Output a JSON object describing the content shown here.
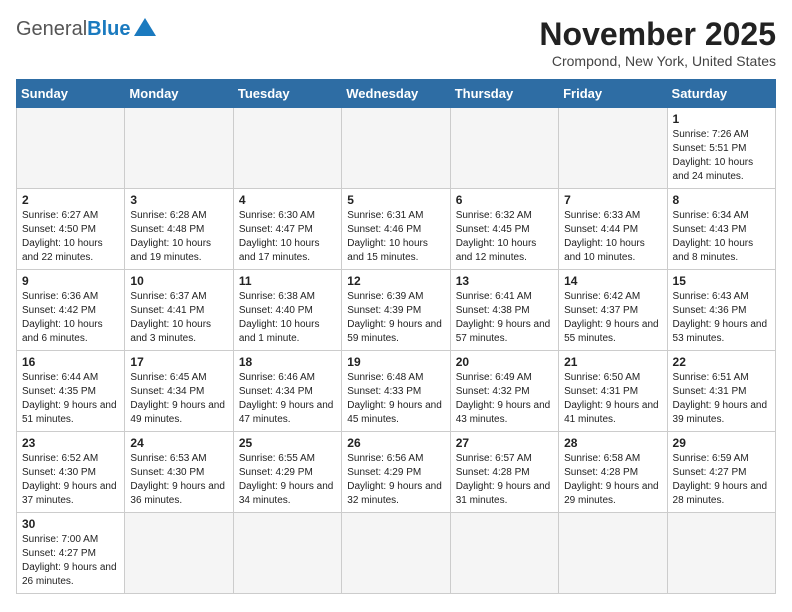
{
  "header": {
    "logo_general": "General",
    "logo_blue": "Blue",
    "title": "November 2025",
    "subtitle": "Crompond, New York, United States"
  },
  "weekdays": [
    "Sunday",
    "Monday",
    "Tuesday",
    "Wednesday",
    "Thursday",
    "Friday",
    "Saturday"
  ],
  "weeks": [
    [
      {
        "day": "",
        "info": "",
        "empty": true
      },
      {
        "day": "",
        "info": "",
        "empty": true
      },
      {
        "day": "",
        "info": "",
        "empty": true
      },
      {
        "day": "",
        "info": "",
        "empty": true
      },
      {
        "day": "",
        "info": "",
        "empty": true
      },
      {
        "day": "",
        "info": "",
        "empty": true
      },
      {
        "day": "1",
        "info": "Sunrise: 7:26 AM\nSunset: 5:51 PM\nDaylight: 10 hours and 24 minutes.",
        "empty": false
      }
    ],
    [
      {
        "day": "2",
        "info": "Sunrise: 6:27 AM\nSunset: 4:50 PM\nDaylight: 10 hours and 22 minutes.",
        "empty": false
      },
      {
        "day": "3",
        "info": "Sunrise: 6:28 AM\nSunset: 4:48 PM\nDaylight: 10 hours and 19 minutes.",
        "empty": false
      },
      {
        "day": "4",
        "info": "Sunrise: 6:30 AM\nSunset: 4:47 PM\nDaylight: 10 hours and 17 minutes.",
        "empty": false
      },
      {
        "day": "5",
        "info": "Sunrise: 6:31 AM\nSunset: 4:46 PM\nDaylight: 10 hours and 15 minutes.",
        "empty": false
      },
      {
        "day": "6",
        "info": "Sunrise: 6:32 AM\nSunset: 4:45 PM\nDaylight: 10 hours and 12 minutes.",
        "empty": false
      },
      {
        "day": "7",
        "info": "Sunrise: 6:33 AM\nSunset: 4:44 PM\nDaylight: 10 hours and 10 minutes.",
        "empty": false
      },
      {
        "day": "8",
        "info": "Sunrise: 6:34 AM\nSunset: 4:43 PM\nDaylight: 10 hours and 8 minutes.",
        "empty": false
      }
    ],
    [
      {
        "day": "9",
        "info": "Sunrise: 6:36 AM\nSunset: 4:42 PM\nDaylight: 10 hours and 6 minutes.",
        "empty": false
      },
      {
        "day": "10",
        "info": "Sunrise: 6:37 AM\nSunset: 4:41 PM\nDaylight: 10 hours and 3 minutes.",
        "empty": false
      },
      {
        "day": "11",
        "info": "Sunrise: 6:38 AM\nSunset: 4:40 PM\nDaylight: 10 hours and 1 minute.",
        "empty": false
      },
      {
        "day": "12",
        "info": "Sunrise: 6:39 AM\nSunset: 4:39 PM\nDaylight: 9 hours and 59 minutes.",
        "empty": false
      },
      {
        "day": "13",
        "info": "Sunrise: 6:41 AM\nSunset: 4:38 PM\nDaylight: 9 hours and 57 minutes.",
        "empty": false
      },
      {
        "day": "14",
        "info": "Sunrise: 6:42 AM\nSunset: 4:37 PM\nDaylight: 9 hours and 55 minutes.",
        "empty": false
      },
      {
        "day": "15",
        "info": "Sunrise: 6:43 AM\nSunset: 4:36 PM\nDaylight: 9 hours and 53 minutes.",
        "empty": false
      }
    ],
    [
      {
        "day": "16",
        "info": "Sunrise: 6:44 AM\nSunset: 4:35 PM\nDaylight: 9 hours and 51 minutes.",
        "empty": false
      },
      {
        "day": "17",
        "info": "Sunrise: 6:45 AM\nSunset: 4:34 PM\nDaylight: 9 hours and 49 minutes.",
        "empty": false
      },
      {
        "day": "18",
        "info": "Sunrise: 6:46 AM\nSunset: 4:34 PM\nDaylight: 9 hours and 47 minutes.",
        "empty": false
      },
      {
        "day": "19",
        "info": "Sunrise: 6:48 AM\nSunset: 4:33 PM\nDaylight: 9 hours and 45 minutes.",
        "empty": false
      },
      {
        "day": "20",
        "info": "Sunrise: 6:49 AM\nSunset: 4:32 PM\nDaylight: 9 hours and 43 minutes.",
        "empty": false
      },
      {
        "day": "21",
        "info": "Sunrise: 6:50 AM\nSunset: 4:31 PM\nDaylight: 9 hours and 41 minutes.",
        "empty": false
      },
      {
        "day": "22",
        "info": "Sunrise: 6:51 AM\nSunset: 4:31 PM\nDaylight: 9 hours and 39 minutes.",
        "empty": false
      }
    ],
    [
      {
        "day": "23",
        "info": "Sunrise: 6:52 AM\nSunset: 4:30 PM\nDaylight: 9 hours and 37 minutes.",
        "empty": false
      },
      {
        "day": "24",
        "info": "Sunrise: 6:53 AM\nSunset: 4:30 PM\nDaylight: 9 hours and 36 minutes.",
        "empty": false
      },
      {
        "day": "25",
        "info": "Sunrise: 6:55 AM\nSunset: 4:29 PM\nDaylight: 9 hours and 34 minutes.",
        "empty": false
      },
      {
        "day": "26",
        "info": "Sunrise: 6:56 AM\nSunset: 4:29 PM\nDaylight: 9 hours and 32 minutes.",
        "empty": false
      },
      {
        "day": "27",
        "info": "Sunrise: 6:57 AM\nSunset: 4:28 PM\nDaylight: 9 hours and 31 minutes.",
        "empty": false
      },
      {
        "day": "28",
        "info": "Sunrise: 6:58 AM\nSunset: 4:28 PM\nDaylight: 9 hours and 29 minutes.",
        "empty": false
      },
      {
        "day": "29",
        "info": "Sunrise: 6:59 AM\nSunset: 4:27 PM\nDaylight: 9 hours and 28 minutes.",
        "empty": false
      }
    ],
    [
      {
        "day": "30",
        "info": "Sunrise: 7:00 AM\nSunset: 4:27 PM\nDaylight: 9 hours and 26 minutes.",
        "empty": false
      },
      {
        "day": "",
        "info": "",
        "empty": true
      },
      {
        "day": "",
        "info": "",
        "empty": true
      },
      {
        "day": "",
        "info": "",
        "empty": true
      },
      {
        "day": "",
        "info": "",
        "empty": true
      },
      {
        "day": "",
        "info": "",
        "empty": true
      },
      {
        "day": "",
        "info": "",
        "empty": true
      }
    ]
  ]
}
